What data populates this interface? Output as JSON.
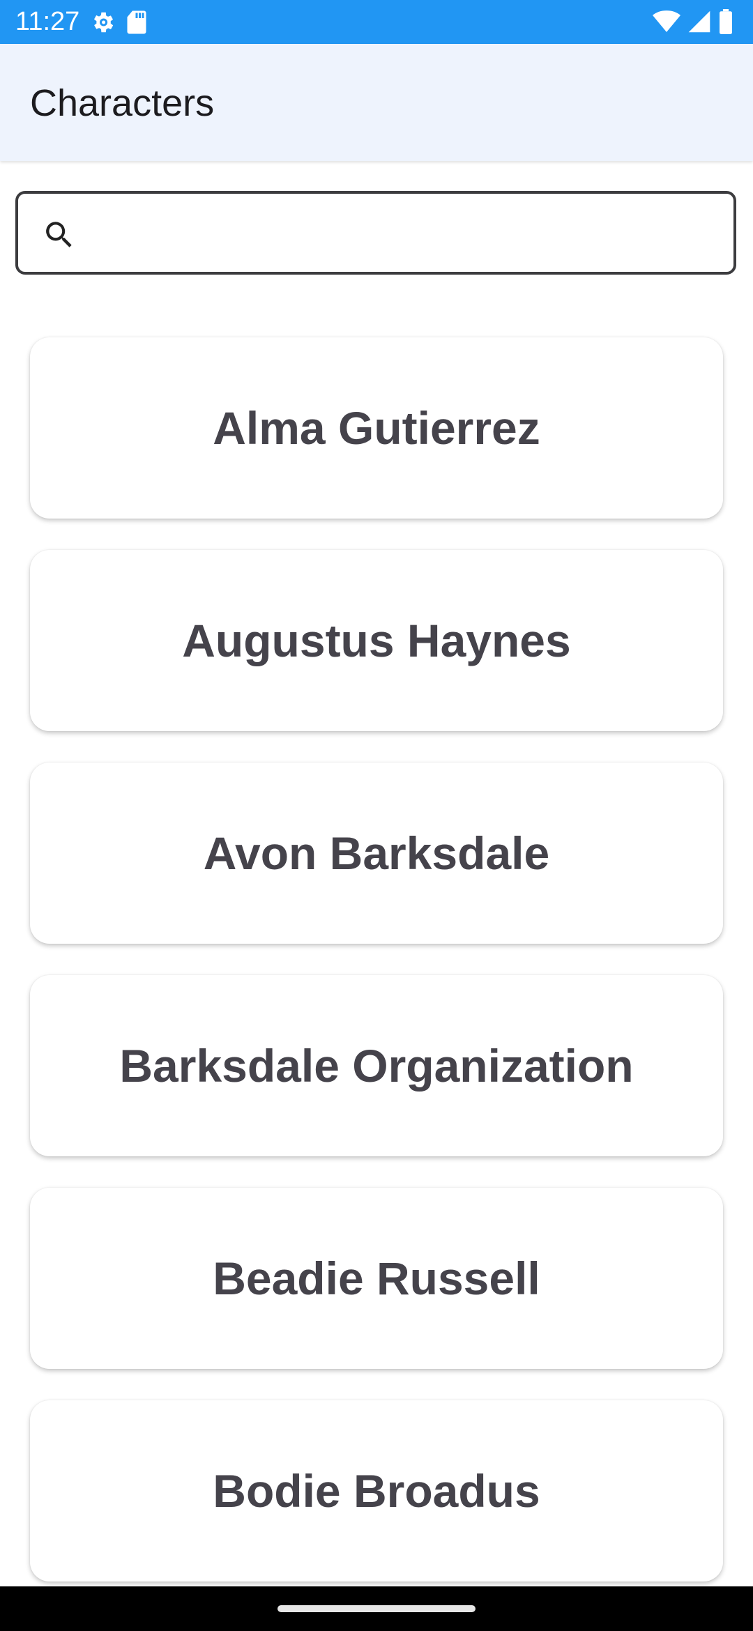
{
  "status_bar": {
    "time": "11:27",
    "left_icons": [
      "settings-icon",
      "sd-card-icon"
    ],
    "right_icons": [
      "wifi-icon",
      "cell-signal-icon",
      "battery-icon"
    ],
    "background_color": "#2196f3"
  },
  "app_bar": {
    "title": "Characters",
    "background_color": "#eef3fd"
  },
  "search": {
    "value": "",
    "placeholder": "",
    "icon": "search-icon"
  },
  "characters": [
    {
      "name": "Alma Gutierrez"
    },
    {
      "name": "Augustus Haynes"
    },
    {
      "name": "Avon Barksdale"
    },
    {
      "name": "Barksdale Organization"
    },
    {
      "name": "Beadie Russell"
    },
    {
      "name": "Bodie Broadus"
    }
  ]
}
